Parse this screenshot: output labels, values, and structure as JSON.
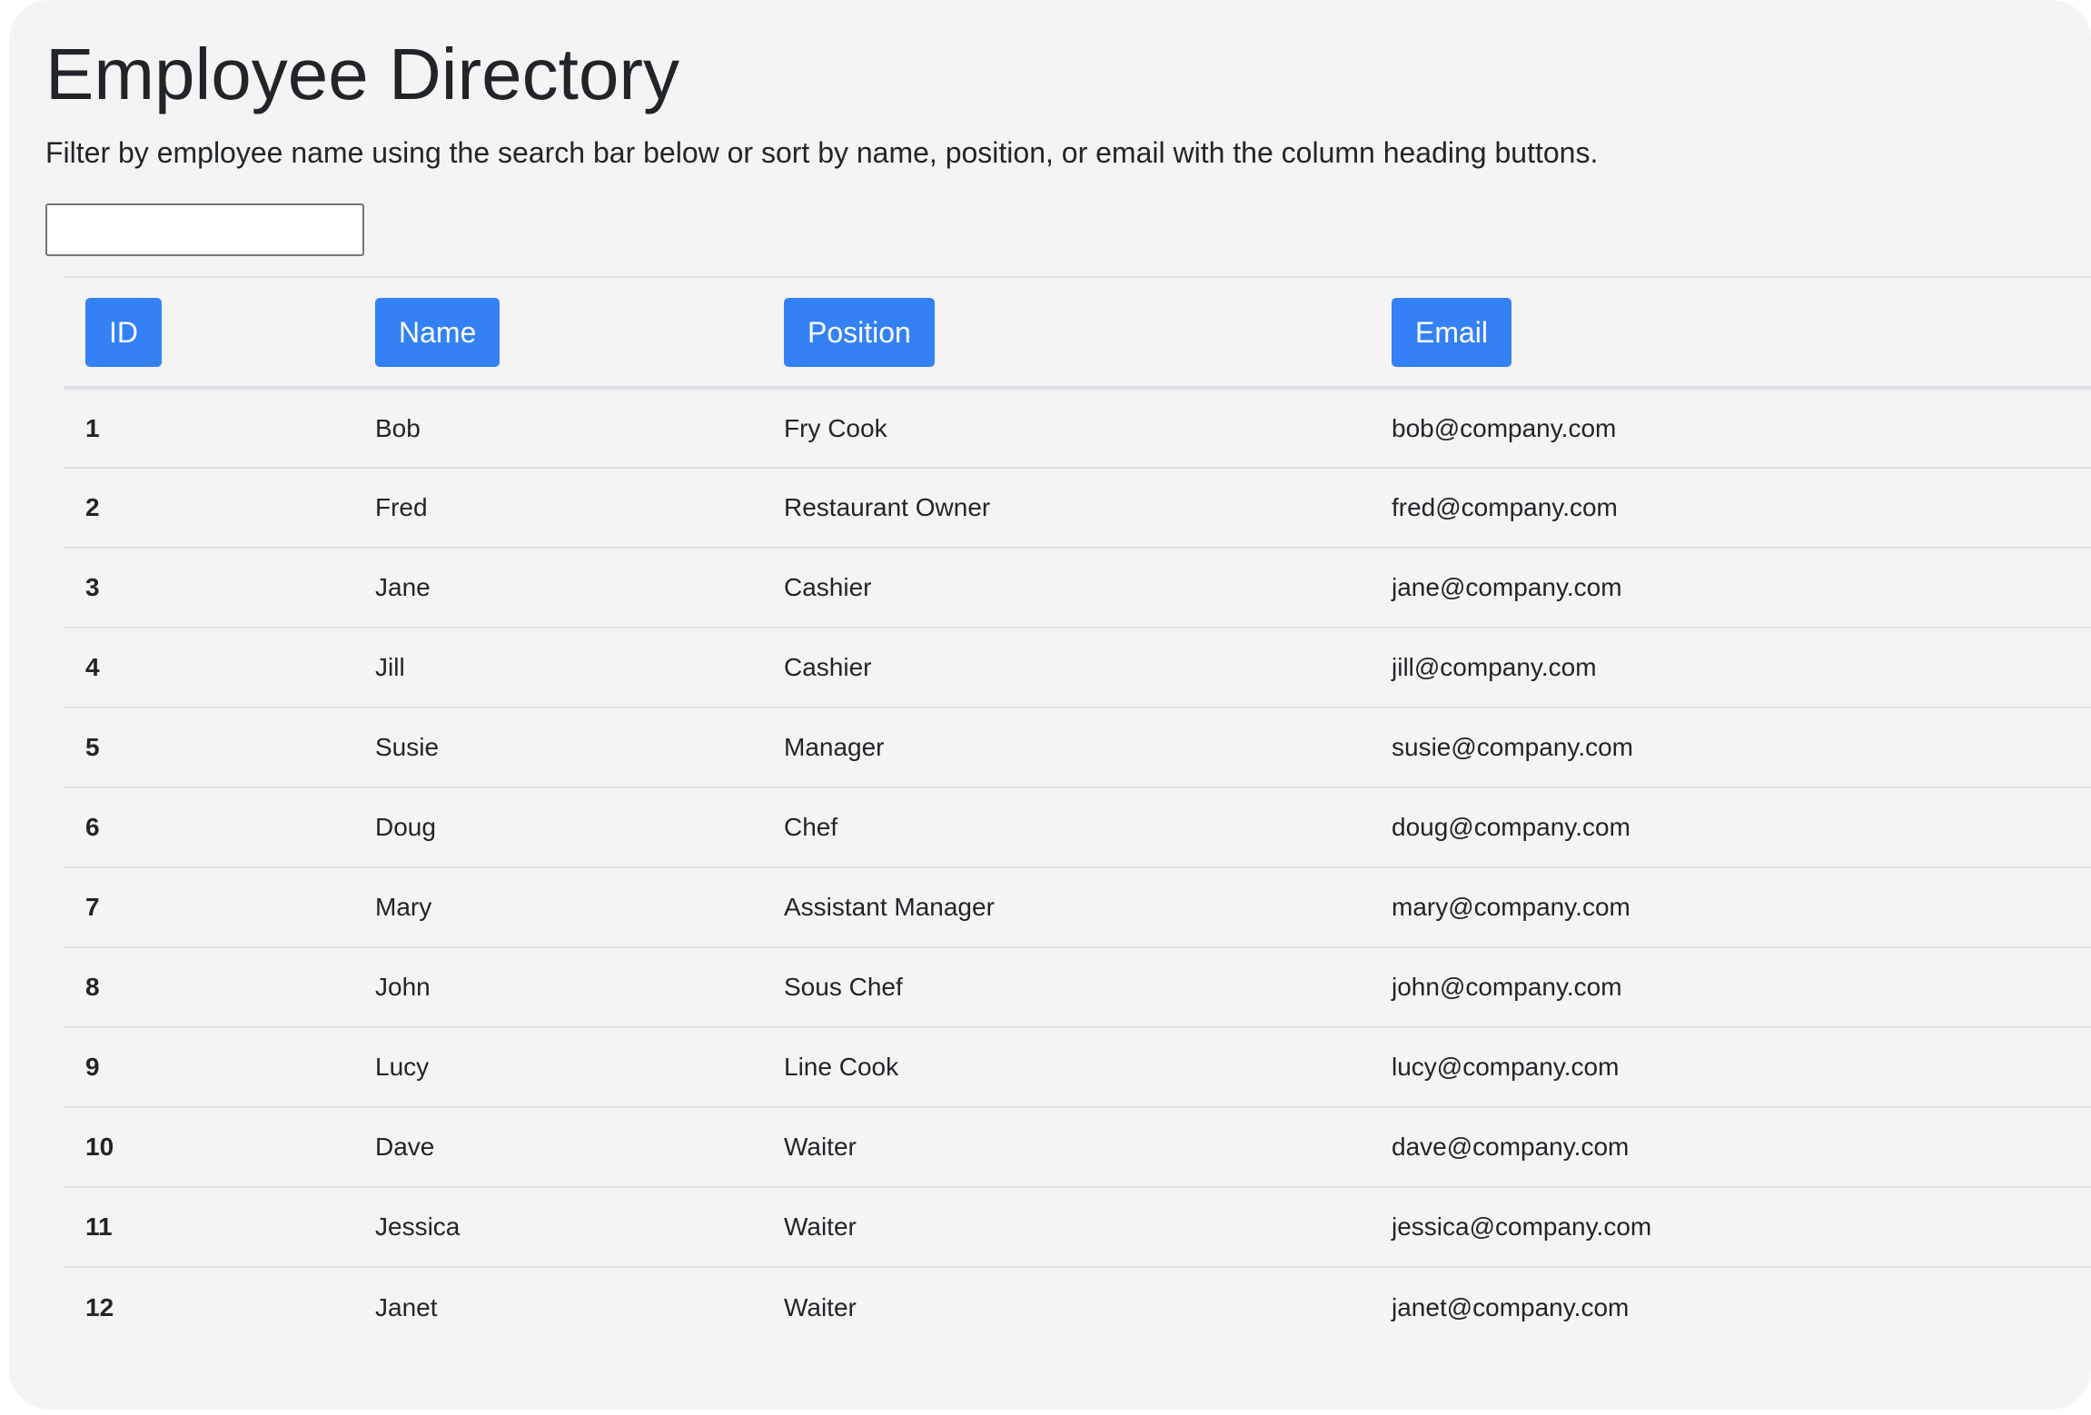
{
  "page": {
    "title": "Employee Directory",
    "subtitle": "Filter by employee name using the search bar below or sort by name, position, or email with the column heading buttons.",
    "search": {
      "value": "",
      "placeholder": ""
    }
  },
  "table": {
    "headers": {
      "id": "ID",
      "name": "Name",
      "position": "Position",
      "email": "Email"
    },
    "rows": [
      {
        "id": "1",
        "name": "Bob",
        "position": "Fry Cook",
        "email": "bob@company.com"
      },
      {
        "id": "2",
        "name": "Fred",
        "position": "Restaurant Owner",
        "email": "fred@company.com"
      },
      {
        "id": "3",
        "name": "Jane",
        "position": "Cashier",
        "email": "jane@company.com"
      },
      {
        "id": "4",
        "name": "Jill",
        "position": "Cashier",
        "email": "jill@company.com"
      },
      {
        "id": "5",
        "name": "Susie",
        "position": "Manager",
        "email": "susie@company.com"
      },
      {
        "id": "6",
        "name": "Doug",
        "position": "Chef",
        "email": "doug@company.com"
      },
      {
        "id": "7",
        "name": "Mary",
        "position": "Assistant Manager",
        "email": "mary@company.com"
      },
      {
        "id": "8",
        "name": "John",
        "position": "Sous Chef",
        "email": "john@company.com"
      },
      {
        "id": "9",
        "name": "Lucy",
        "position": "Line Cook",
        "email": "lucy@company.com"
      },
      {
        "id": "10",
        "name": "Dave",
        "position": "Waiter",
        "email": "dave@company.com"
      },
      {
        "id": "11",
        "name": "Jessica",
        "position": "Waiter",
        "email": "jessica@company.com"
      },
      {
        "id": "12",
        "name": "Janet",
        "position": "Waiter",
        "email": "janet@company.com"
      }
    ]
  },
  "colors": {
    "button": "#3481f6",
    "button_text": "#ffffff",
    "background": "#f4f4f4",
    "text": "#212529",
    "divider": "#dee2e6"
  }
}
